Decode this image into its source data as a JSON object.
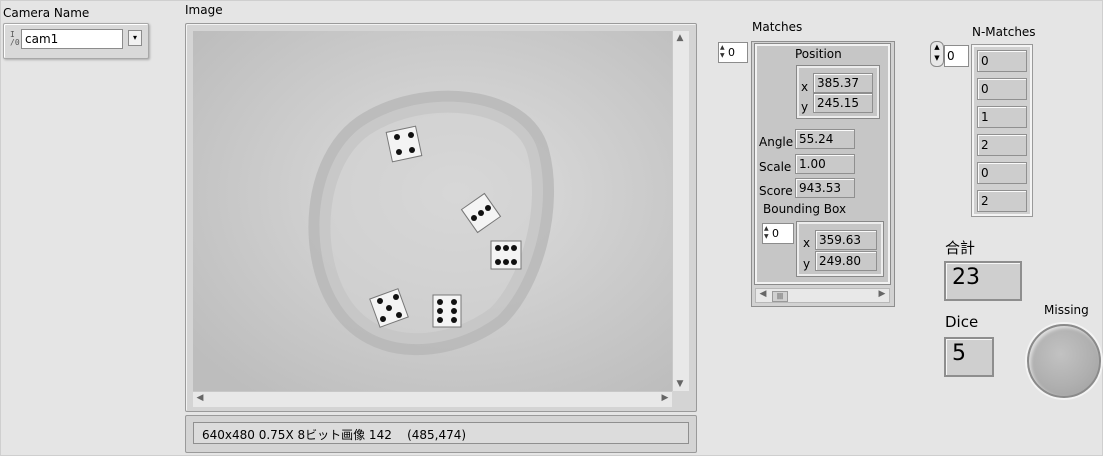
{
  "camera": {
    "label": "Camera Name",
    "io_glyph": "I/O",
    "value": "cam1"
  },
  "image": {
    "label": "Image",
    "status": "640x480 0.75X 8ビット画像 142    (485,474)"
  },
  "matches": {
    "label": "Matches",
    "index": "0",
    "position": {
      "label": "Position",
      "x_label": "x",
      "x": "385.37",
      "y_label": "y",
      "y": "245.15"
    },
    "angle_label": "Angle",
    "angle": "55.24",
    "scale_label": "Scale",
    "scale": "1.00",
    "score_label": "Score",
    "score": "943.53",
    "bbox": {
      "label": "Bounding Box",
      "index": "0",
      "x_label": "x",
      "x": "359.63",
      "y_label": "y",
      "y": "249.80"
    }
  },
  "n_matches": {
    "label": "N-Matches",
    "index": "0",
    "values": [
      "0",
      "0",
      "1",
      "2",
      "0",
      "2"
    ]
  },
  "total": {
    "label": "合計",
    "value": "23"
  },
  "dice": {
    "label": "Dice",
    "value": "5"
  },
  "missing": {
    "label": "Missing",
    "led_color": "#b4b4b4"
  }
}
